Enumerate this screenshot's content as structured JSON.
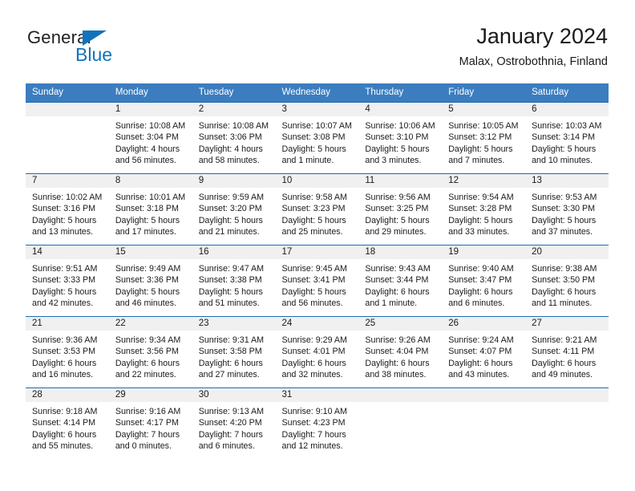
{
  "brand": {
    "name_part1": "General",
    "name_part2": "Blue",
    "accent_color": "#1173bb"
  },
  "header": {
    "title": "January 2024",
    "subtitle": "Malax, Ostrobothnia, Finland"
  },
  "calendar": {
    "header_bg": "#3b7dbf",
    "row_divider_color": "#1f6cb0",
    "daynum_band_color": "#f0f0f0",
    "weekdays": [
      "Sunday",
      "Monday",
      "Tuesday",
      "Wednesday",
      "Thursday",
      "Friday",
      "Saturday"
    ],
    "weeks": [
      [
        {
          "day": "",
          "sunrise": "",
          "sunset": "",
          "daylight1": "",
          "daylight2": ""
        },
        {
          "day": "1",
          "sunrise": "Sunrise: 10:08 AM",
          "sunset": "Sunset: 3:04 PM",
          "daylight1": "Daylight: 4 hours",
          "daylight2": "and 56 minutes."
        },
        {
          "day": "2",
          "sunrise": "Sunrise: 10:08 AM",
          "sunset": "Sunset: 3:06 PM",
          "daylight1": "Daylight: 4 hours",
          "daylight2": "and 58 minutes."
        },
        {
          "day": "3",
          "sunrise": "Sunrise: 10:07 AM",
          "sunset": "Sunset: 3:08 PM",
          "daylight1": "Daylight: 5 hours",
          "daylight2": "and 1 minute."
        },
        {
          "day": "4",
          "sunrise": "Sunrise: 10:06 AM",
          "sunset": "Sunset: 3:10 PM",
          "daylight1": "Daylight: 5 hours",
          "daylight2": "and 3 minutes."
        },
        {
          "day": "5",
          "sunrise": "Sunrise: 10:05 AM",
          "sunset": "Sunset: 3:12 PM",
          "daylight1": "Daylight: 5 hours",
          "daylight2": "and 7 minutes."
        },
        {
          "day": "6",
          "sunrise": "Sunrise: 10:03 AM",
          "sunset": "Sunset: 3:14 PM",
          "daylight1": "Daylight: 5 hours",
          "daylight2": "and 10 minutes."
        }
      ],
      [
        {
          "day": "7",
          "sunrise": "Sunrise: 10:02 AM",
          "sunset": "Sunset: 3:16 PM",
          "daylight1": "Daylight: 5 hours",
          "daylight2": "and 13 minutes."
        },
        {
          "day": "8",
          "sunrise": "Sunrise: 10:01 AM",
          "sunset": "Sunset: 3:18 PM",
          "daylight1": "Daylight: 5 hours",
          "daylight2": "and 17 minutes."
        },
        {
          "day": "9",
          "sunrise": "Sunrise: 9:59 AM",
          "sunset": "Sunset: 3:20 PM",
          "daylight1": "Daylight: 5 hours",
          "daylight2": "and 21 minutes."
        },
        {
          "day": "10",
          "sunrise": "Sunrise: 9:58 AM",
          "sunset": "Sunset: 3:23 PM",
          "daylight1": "Daylight: 5 hours",
          "daylight2": "and 25 minutes."
        },
        {
          "day": "11",
          "sunrise": "Sunrise: 9:56 AM",
          "sunset": "Sunset: 3:25 PM",
          "daylight1": "Daylight: 5 hours",
          "daylight2": "and 29 minutes."
        },
        {
          "day": "12",
          "sunrise": "Sunrise: 9:54 AM",
          "sunset": "Sunset: 3:28 PM",
          "daylight1": "Daylight: 5 hours",
          "daylight2": "and 33 minutes."
        },
        {
          "day": "13",
          "sunrise": "Sunrise: 9:53 AM",
          "sunset": "Sunset: 3:30 PM",
          "daylight1": "Daylight: 5 hours",
          "daylight2": "and 37 minutes."
        }
      ],
      [
        {
          "day": "14",
          "sunrise": "Sunrise: 9:51 AM",
          "sunset": "Sunset: 3:33 PM",
          "daylight1": "Daylight: 5 hours",
          "daylight2": "and 42 minutes."
        },
        {
          "day": "15",
          "sunrise": "Sunrise: 9:49 AM",
          "sunset": "Sunset: 3:36 PM",
          "daylight1": "Daylight: 5 hours",
          "daylight2": "and 46 minutes."
        },
        {
          "day": "16",
          "sunrise": "Sunrise: 9:47 AM",
          "sunset": "Sunset: 3:38 PM",
          "daylight1": "Daylight: 5 hours",
          "daylight2": "and 51 minutes."
        },
        {
          "day": "17",
          "sunrise": "Sunrise: 9:45 AM",
          "sunset": "Sunset: 3:41 PM",
          "daylight1": "Daylight: 5 hours",
          "daylight2": "and 56 minutes."
        },
        {
          "day": "18",
          "sunrise": "Sunrise: 9:43 AM",
          "sunset": "Sunset: 3:44 PM",
          "daylight1": "Daylight: 6 hours",
          "daylight2": "and 1 minute."
        },
        {
          "day": "19",
          "sunrise": "Sunrise: 9:40 AM",
          "sunset": "Sunset: 3:47 PM",
          "daylight1": "Daylight: 6 hours",
          "daylight2": "and 6 minutes."
        },
        {
          "day": "20",
          "sunrise": "Sunrise: 9:38 AM",
          "sunset": "Sunset: 3:50 PM",
          "daylight1": "Daylight: 6 hours",
          "daylight2": "and 11 minutes."
        }
      ],
      [
        {
          "day": "21",
          "sunrise": "Sunrise: 9:36 AM",
          "sunset": "Sunset: 3:53 PM",
          "daylight1": "Daylight: 6 hours",
          "daylight2": "and 16 minutes."
        },
        {
          "day": "22",
          "sunrise": "Sunrise: 9:34 AM",
          "sunset": "Sunset: 3:56 PM",
          "daylight1": "Daylight: 6 hours",
          "daylight2": "and 22 minutes."
        },
        {
          "day": "23",
          "sunrise": "Sunrise: 9:31 AM",
          "sunset": "Sunset: 3:58 PM",
          "daylight1": "Daylight: 6 hours",
          "daylight2": "and 27 minutes."
        },
        {
          "day": "24",
          "sunrise": "Sunrise: 9:29 AM",
          "sunset": "Sunset: 4:01 PM",
          "daylight1": "Daylight: 6 hours",
          "daylight2": "and 32 minutes."
        },
        {
          "day": "25",
          "sunrise": "Sunrise: 9:26 AM",
          "sunset": "Sunset: 4:04 PM",
          "daylight1": "Daylight: 6 hours",
          "daylight2": "and 38 minutes."
        },
        {
          "day": "26",
          "sunrise": "Sunrise: 9:24 AM",
          "sunset": "Sunset: 4:07 PM",
          "daylight1": "Daylight: 6 hours",
          "daylight2": "and 43 minutes."
        },
        {
          "day": "27",
          "sunrise": "Sunrise: 9:21 AM",
          "sunset": "Sunset: 4:11 PM",
          "daylight1": "Daylight: 6 hours",
          "daylight2": "and 49 minutes."
        }
      ],
      [
        {
          "day": "28",
          "sunrise": "Sunrise: 9:18 AM",
          "sunset": "Sunset: 4:14 PM",
          "daylight1": "Daylight: 6 hours",
          "daylight2": "and 55 minutes."
        },
        {
          "day": "29",
          "sunrise": "Sunrise: 9:16 AM",
          "sunset": "Sunset: 4:17 PM",
          "daylight1": "Daylight: 7 hours",
          "daylight2": "and 0 minutes."
        },
        {
          "day": "30",
          "sunrise": "Sunrise: 9:13 AM",
          "sunset": "Sunset: 4:20 PM",
          "daylight1": "Daylight: 7 hours",
          "daylight2": "and 6 minutes."
        },
        {
          "day": "31",
          "sunrise": "Sunrise: 9:10 AM",
          "sunset": "Sunset: 4:23 PM",
          "daylight1": "Daylight: 7 hours",
          "daylight2": "and 12 minutes."
        },
        {
          "day": "",
          "sunrise": "",
          "sunset": "",
          "daylight1": "",
          "daylight2": ""
        },
        {
          "day": "",
          "sunrise": "",
          "sunset": "",
          "daylight1": "",
          "daylight2": ""
        },
        {
          "day": "",
          "sunrise": "",
          "sunset": "",
          "daylight1": "",
          "daylight2": ""
        }
      ]
    ]
  }
}
